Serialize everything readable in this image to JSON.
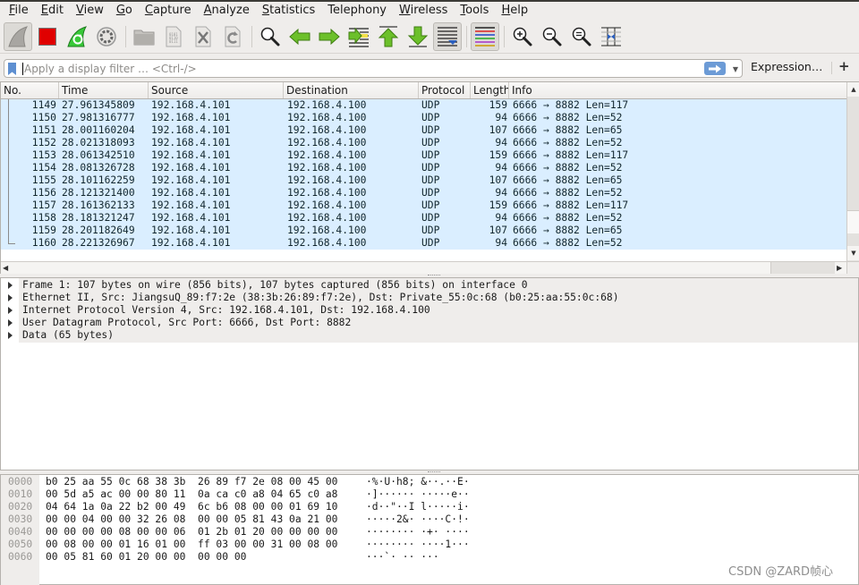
{
  "menubar": {
    "items": [
      {
        "accel": "F",
        "rest": "ile"
      },
      {
        "accel": "E",
        "rest": "dit"
      },
      {
        "accel": "V",
        "rest": "iew"
      },
      {
        "accel": "G",
        "rest": "o"
      },
      {
        "accel": "C",
        "rest": "apture"
      },
      {
        "accel": "A",
        "rest": "nalyze"
      },
      {
        "accel": "S",
        "rest": "tatistics"
      },
      {
        "accel": "",
        "rest": "Telephony"
      },
      {
        "accel": "W",
        "rest": "ireless"
      },
      {
        "accel": "T",
        "rest": "ools"
      },
      {
        "accel": "H",
        "rest": "elp"
      }
    ]
  },
  "toolbar": {
    "buttons": [
      "start-capture-icon",
      "stop-capture-icon",
      "restart-capture-icon",
      "capture-options-icon",
      "open-file-icon",
      "save-file-icon",
      "close-file-icon",
      "reload-file-icon",
      "find-packet-icon",
      "go-back-icon",
      "go-forward-icon",
      "go-to-packet-icon",
      "first-packet-icon",
      "last-packet-icon",
      "autoscroll-icon",
      "colorize-icon",
      "zoom-in-icon",
      "zoom-out-icon",
      "normal-size-icon",
      "resize-columns-icon"
    ]
  },
  "filter": {
    "placeholder": "Apply a display filter … <Ctrl-/>",
    "value": "",
    "expression_label": "Expression…",
    "add_label": "+"
  },
  "packet_list": {
    "columns": [
      "No.",
      "Time",
      "Source",
      "Destination",
      "Protocol",
      "Length",
      "Info"
    ],
    "rows": [
      {
        "no": "1149",
        "time": "27.961345809",
        "src": "192.168.4.101",
        "dst": "192.168.4.100",
        "proto": "UDP",
        "len": "159",
        "info": "6666 → 8882 Len=117"
      },
      {
        "no": "1150",
        "time": "27.981316777",
        "src": "192.168.4.101",
        "dst": "192.168.4.100",
        "proto": "UDP",
        "len": "94",
        "info": "6666 → 8882 Len=52"
      },
      {
        "no": "1151",
        "time": "28.001160204",
        "src": "192.168.4.101",
        "dst": "192.168.4.100",
        "proto": "UDP",
        "len": "107",
        "info": "6666 → 8882 Len=65"
      },
      {
        "no": "1152",
        "time": "28.021318093",
        "src": "192.168.4.101",
        "dst": "192.168.4.100",
        "proto": "UDP",
        "len": "94",
        "info": "6666 → 8882 Len=52"
      },
      {
        "no": "1153",
        "time": "28.061342510",
        "src": "192.168.4.101",
        "dst": "192.168.4.100",
        "proto": "UDP",
        "len": "159",
        "info": "6666 → 8882 Len=117"
      },
      {
        "no": "1154",
        "time": "28.081326728",
        "src": "192.168.4.101",
        "dst": "192.168.4.100",
        "proto": "UDP",
        "len": "94",
        "info": "6666 → 8882 Len=52"
      },
      {
        "no": "1155",
        "time": "28.101162259",
        "src": "192.168.4.101",
        "dst": "192.168.4.100",
        "proto": "UDP",
        "len": "107",
        "info": "6666 → 8882 Len=65"
      },
      {
        "no": "1156",
        "time": "28.121321400",
        "src": "192.168.4.101",
        "dst": "192.168.4.100",
        "proto": "UDP",
        "len": "94",
        "info": "6666 → 8882 Len=52"
      },
      {
        "no": "1157",
        "time": "28.161362133",
        "src": "192.168.4.101",
        "dst": "192.168.4.100",
        "proto": "UDP",
        "len": "159",
        "info": "6666 → 8882 Len=117"
      },
      {
        "no": "1158",
        "time": "28.181321247",
        "src": "192.168.4.101",
        "dst": "192.168.4.100",
        "proto": "UDP",
        "len": "94",
        "info": "6666 → 8882 Len=52"
      },
      {
        "no": "1159",
        "time": "28.201182649",
        "src": "192.168.4.101",
        "dst": "192.168.4.100",
        "proto": "UDP",
        "len": "107",
        "info": "6666 → 8882 Len=65"
      },
      {
        "no": "1160",
        "time": "28.221326967",
        "src": "192.168.4.101",
        "dst": "192.168.4.100",
        "proto": "UDP",
        "len": "94",
        "info": "6666 → 8882 Len=52"
      }
    ],
    "row_color": "#daeeff"
  },
  "details": {
    "items": [
      "Frame 1: 107 bytes on wire (856 bits), 107 bytes captured (856 bits) on interface 0",
      "Ethernet II, Src: JiangsuQ_89:f7:2e (38:3b:26:89:f7:2e), Dst: Private_55:0c:68 (b0:25:aa:55:0c:68)",
      "Internet Protocol Version 4, Src: 192.168.4.101, Dst: 192.168.4.100",
      "User Datagram Protocol, Src Port: 6666, Dst Port: 8882",
      "Data (65 bytes)"
    ]
  },
  "bytes": {
    "rows": [
      {
        "offset": "0000",
        "hex": "b0 25 aa 55 0c 68 38 3b  26 89 f7 2e 08 00 45 00",
        "ascii": "·%·U·h8; &··.··E·"
      },
      {
        "offset": "0010",
        "hex": "00 5d a5 ac 00 00 80 11  0a ca c0 a8 04 65 c0 a8",
        "ascii": "·]······ ·····e··"
      },
      {
        "offset": "0020",
        "hex": "04 64 1a 0a 22 b2 00 49  6c b6 08 00 00 01 69 10",
        "ascii": "·d··\"··I l·····i·"
      },
      {
        "offset": "0030",
        "hex": "00 00 04 00 00 32 26 08  00 00 05 81 43 0a 21 00",
        "ascii": "·····2&· ····C·!·"
      },
      {
        "offset": "0040",
        "hex": "00 00 00 00 08 00 00 06  01 2b 01 20 00 00 00 00",
        "ascii": "········ ·+· ····"
      },
      {
        "offset": "0050",
        "hex": "00 08 00 00 01 16 01 00  ff 03 00 00 31 00 08 00",
        "ascii": "········ ····1···"
      },
      {
        "offset": "0060",
        "hex": "00 05 81 60 01 20 00 00  00 00 00",
        "ascii": "···`· ·· ···"
      }
    ]
  },
  "watermark": "CSDN @ZARD帧心"
}
